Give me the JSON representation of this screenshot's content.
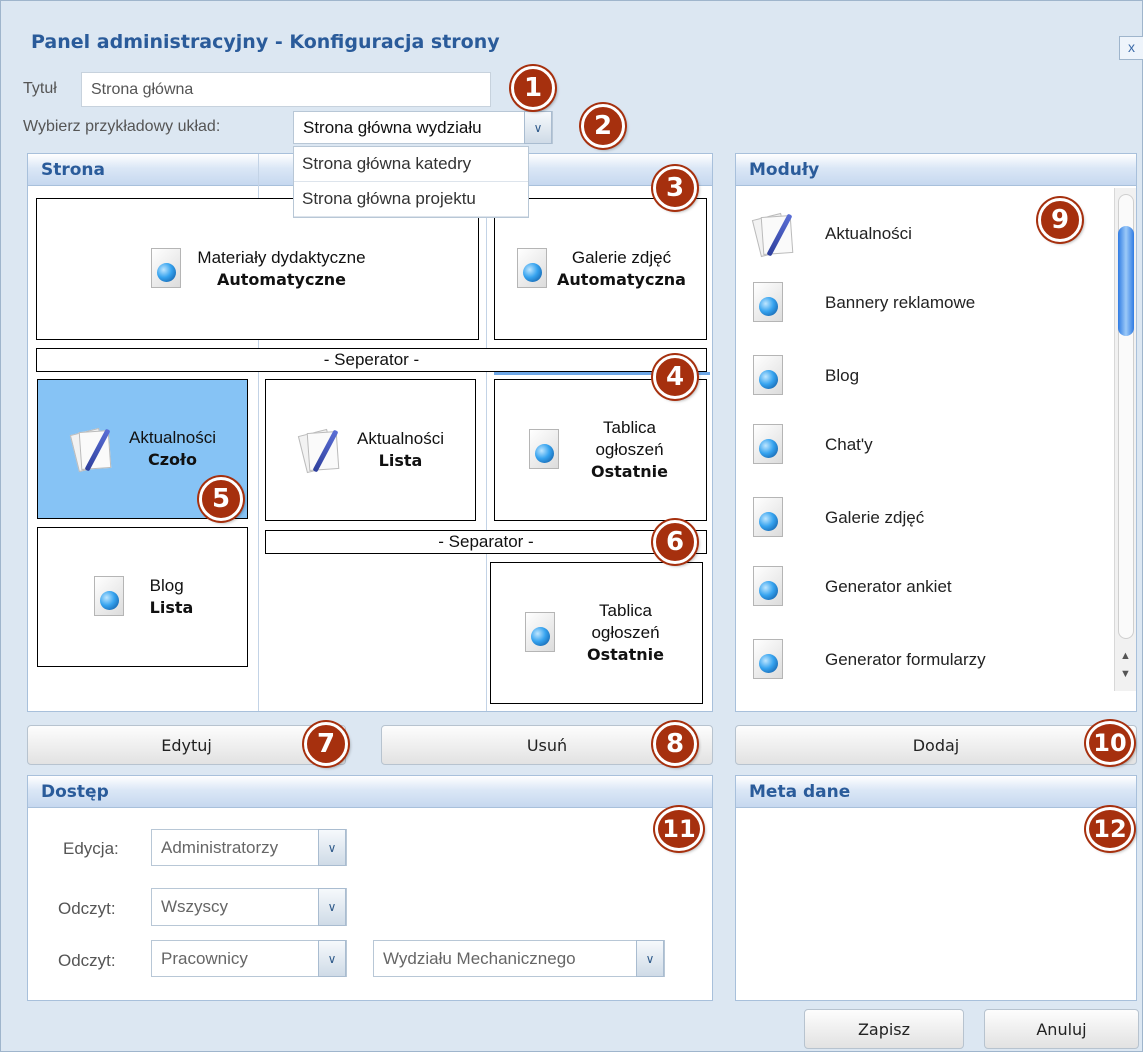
{
  "dialog": {
    "title": "Panel administracyjny - Konfiguracja strony",
    "close_label": "x"
  },
  "form": {
    "title_label": "Tytuł",
    "title_value": "Strona główna",
    "layout_label": "Wybierz przykładowy układ:",
    "layout_selected": "Strona główna wydziału",
    "layout_options": [
      "Strona główna katedry",
      "Strona główna projektu"
    ]
  },
  "page_panel": {
    "heading": "Strona",
    "boxes": [
      {
        "title": "Materiały dydaktyczne",
        "mode": "Automatyczne",
        "icon": "document-globe-icon"
      },
      {
        "title": "Galerie zdjęć",
        "mode": "Automatyczna",
        "icon": "document-globe-icon"
      },
      {
        "title": "Aktualności",
        "mode": "Czoło",
        "icon": "news-pen-icon",
        "selected": true
      },
      {
        "title": "Aktualności",
        "mode": "Lista",
        "icon": "news-pen-icon"
      },
      {
        "title": "Tablica ogłoszeń",
        "mode": "Ostatnie",
        "icon": "document-globe-icon"
      },
      {
        "title": "Blog",
        "mode": "Lista",
        "icon": "document-globe-icon"
      },
      {
        "title": "Tablica ogłoszeń",
        "mode": "Ostatnie",
        "icon": "document-globe-icon"
      }
    ],
    "separator_1": "- Seperator -",
    "separator_2": "- Separator -"
  },
  "modules_panel": {
    "heading": "Moduły",
    "items": [
      {
        "name": "Aktualności",
        "icon": "news-pen-icon"
      },
      {
        "name": "Bannery reklamowe",
        "icon": "document-globe-icon"
      },
      {
        "name": "Blog",
        "icon": "document-globe-icon"
      },
      {
        "name": "Chat'y",
        "icon": "document-globe-icon"
      },
      {
        "name": "Galerie zdjęć",
        "icon": "document-globe-icon"
      },
      {
        "name": "Generator ankiet",
        "icon": "document-globe-icon"
      },
      {
        "name": "Generator formularzy",
        "icon": "document-globe-icon"
      }
    ]
  },
  "actions": {
    "edit": "Edytuj",
    "remove": "Usuń",
    "add": "Dodaj"
  },
  "access_panel": {
    "heading": "Dostęp",
    "edit_label": "Edycja:",
    "edit_value": "Administratorzy",
    "read_label_1": "Odczyt:",
    "read_value_1": "Wszyscy",
    "read_label_2": "Odczyt:",
    "read_value_2": "Pracownicy",
    "read_scope_value": "Wydziału Mechanicznego"
  },
  "meta_panel": {
    "heading": "Meta dane"
  },
  "footer": {
    "save": "Zapisz",
    "cancel": "Anuluj"
  },
  "markers": [
    "1",
    "2",
    "3",
    "4",
    "5",
    "6",
    "7",
    "8",
    "9",
    "10",
    "11",
    "12"
  ],
  "colors": {
    "title": "#2a5b9a",
    "background": "#dce7f2",
    "selected_box": "#86c3f5",
    "marker": "#a6300e"
  }
}
